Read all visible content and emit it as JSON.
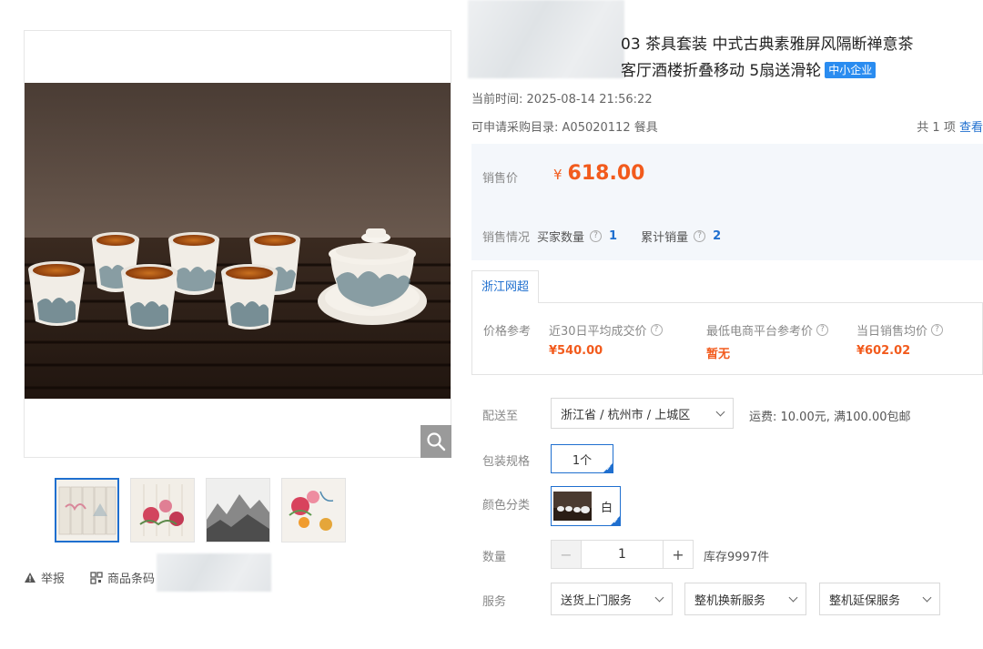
{
  "product": {
    "title_line1": "03 茶具套装 中式古典素雅屏风隔断禅意茶",
    "title_line2": "客厅酒楼折叠移动 5扇送滑轮",
    "badge": "中小企业"
  },
  "meta": {
    "time_label": "当前时间:",
    "time_value": "2025-08-14 21:56:22",
    "catalog_label": "可申请采购目录:",
    "catalog_value": "A05020112 餐具",
    "count_text": "共 1 项",
    "view_link": "查看"
  },
  "price": {
    "label": "销售价",
    "currency": "¥",
    "value": "618.00"
  },
  "sales": {
    "label": "销售情况",
    "buyers_label": "买家数量",
    "buyers_value": "1",
    "cumulative_label": "累计销量",
    "cumulative_value": "2"
  },
  "reference": {
    "tab": "浙江网超",
    "label": "价格参考",
    "cols": [
      {
        "label": "近30日平均成交价",
        "value": "¥540.00"
      },
      {
        "label": "最低电商平台参考价",
        "value": "暂无"
      },
      {
        "label": "当日销售均价",
        "value": "¥602.02"
      }
    ]
  },
  "delivery": {
    "label": "配送至",
    "value": "浙江省 / 杭州市 / 上城区",
    "shipping": "运费: 10.00元, 满100.00包邮"
  },
  "package": {
    "label": "包装规格",
    "option": "1个"
  },
  "color": {
    "label": "颜色分类",
    "option": "白"
  },
  "quantity": {
    "label": "数量",
    "minus": "−",
    "value": "1",
    "plus": "+",
    "stock": "库存9997件"
  },
  "service": {
    "label": "服务",
    "options": [
      "送货上门服务",
      "整机换新服务",
      "整机延保服务"
    ]
  },
  "left_links": {
    "report": "举报",
    "barcode": "商品条码"
  },
  "icons": {
    "zoom": "search-icon",
    "report": "warning-icon",
    "barcode": "barcode-icon",
    "help": "question-circle-icon",
    "dropdown": "chevron-down-icon"
  },
  "colors": {
    "accent": "#1f6fcf",
    "price": "#f25b1d",
    "badge": "#2a8cf0"
  }
}
